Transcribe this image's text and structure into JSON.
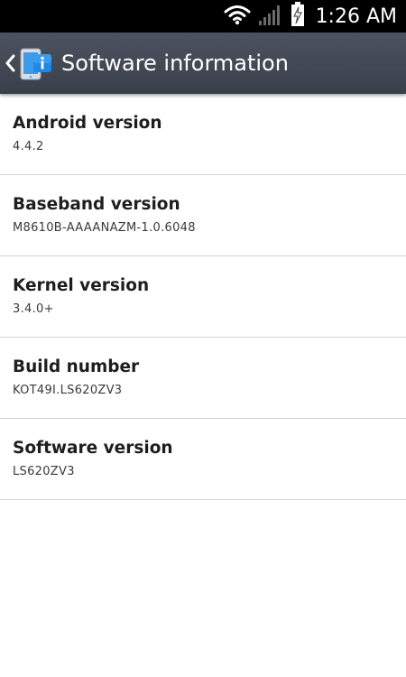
{
  "status_bar": {
    "time": "1:26 AM",
    "icons": [
      "wifi-icon",
      "signal-icon",
      "battery-charging-icon"
    ]
  },
  "action_bar": {
    "title": "Software information",
    "back_icon": "chevron-left-icon",
    "app_icon": "phone-info-icon"
  },
  "items": [
    {
      "title": "Android version",
      "value": "4.4.2"
    },
    {
      "title": "Baseband version",
      "value": "M8610B-AAAANAZM-1.0.6048"
    },
    {
      "title": "Kernel version",
      "value": "3.4.0+"
    },
    {
      "title": "Build number",
      "value": "KOT49I.LS620ZV3"
    },
    {
      "title": "Software version",
      "value": "LS620ZV3"
    }
  ]
}
